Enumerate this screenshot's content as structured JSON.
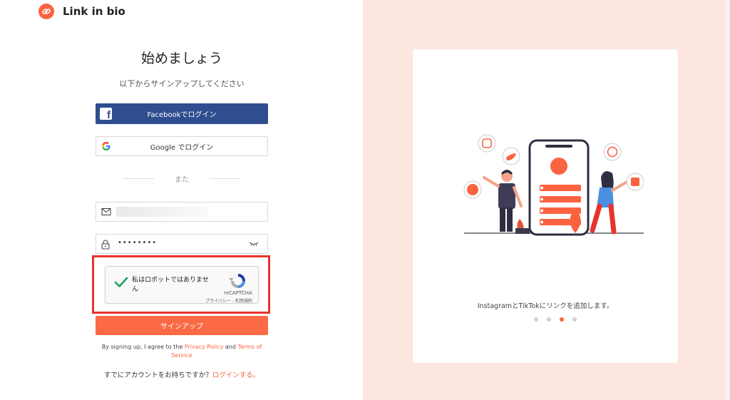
{
  "brand": {
    "name": "Link in bio",
    "accent": "#fb6340"
  },
  "signup": {
    "title": "始めましょう",
    "subtitle": "以下からサインアップしてください",
    "facebook_label": "Facebookでログイン",
    "google_label": "Google でログイン",
    "divider_label": "また",
    "password_masked": "••••••••",
    "submit_label": "サインアップ"
  },
  "recaptcha": {
    "label": "私はロボットではありません",
    "brand": "reCAPTCHA",
    "privacy": "プライバシー",
    "separator": " - ",
    "terms": "利用規約",
    "checked": true
  },
  "legal": {
    "prefix": "By signing up, I agree to the ",
    "privacy_link": "Privacy Policy",
    "and": " and ",
    "terms_link": "Terms of Service"
  },
  "login": {
    "prompt": "すでにアカウントをお持ちですか？",
    "link": "ログインする。"
  },
  "promo": {
    "caption": "InstagramとTikTokにリンクを追加します。",
    "slides": 4,
    "active_slide": 3
  },
  "colors": {
    "facebook": "#2f4d8f",
    "signup_button": "#fb6a45",
    "right_panel": "#fde6e0",
    "highlight": "#e8322c"
  }
}
